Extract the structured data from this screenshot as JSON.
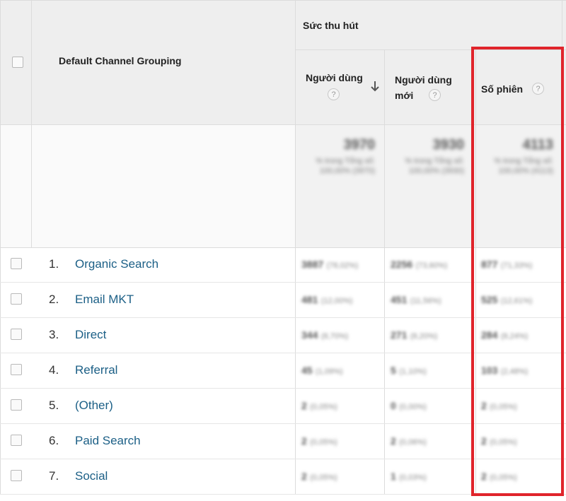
{
  "table": {
    "header_group": "Sức thu hút",
    "dimension_header": "Default Channel Grouping",
    "columns": [
      {
        "label": "Người dùng",
        "help": "?",
        "sorted_desc": true
      },
      {
        "label": "Người dùng mới",
        "help": "?"
      },
      {
        "label": "Số phiên",
        "help": "?"
      }
    ],
    "totals": [
      {
        "value": "3970",
        "sub": "% trong Tổng số: 100,00% (3970)"
      },
      {
        "value": "3930",
        "sub": "% trong Tổng số: 100,00% (3930)"
      },
      {
        "value": "4113",
        "sub": "% trong Tổng số: 100,00% (4113)"
      }
    ],
    "rows": [
      {
        "num": "1.",
        "channel": "Organic Search",
        "users": "3887",
        "users_pct": "(78,02%)",
        "new": "2256",
        "new_pct": "(73,60%)",
        "sessions": "877",
        "sessions_pct": "(71,33%)"
      },
      {
        "num": "2.",
        "channel": "Email MKT",
        "users": "481",
        "users_pct": "(12,00%)",
        "new": "451",
        "new_pct": "(11,56%)",
        "sessions": "525",
        "sessions_pct": "(12,61%)"
      },
      {
        "num": "3.",
        "channel": "Direct",
        "users": "344",
        "users_pct": "(8,70%)",
        "new": "271",
        "new_pct": "(8,20%)",
        "sessions": "284",
        "sessions_pct": "(8,24%)"
      },
      {
        "num": "4.",
        "channel": "Referral",
        "users": "45",
        "users_pct": "(1,09%)",
        "new": "5",
        "new_pct": "(1,10%)",
        "sessions": "103",
        "sessions_pct": "(2,48%)"
      },
      {
        "num": "5.",
        "channel": "(Other)",
        "users": "2",
        "users_pct": "(0,05%)",
        "new": "0",
        "new_pct": "(0,00%)",
        "sessions": "2",
        "sessions_pct": "(0,05%)"
      },
      {
        "num": "6.",
        "channel": "Paid Search",
        "users": "2",
        "users_pct": "(0,05%)",
        "new": "2",
        "new_pct": "(0,06%)",
        "sessions": "2",
        "sessions_pct": "(0,05%)"
      },
      {
        "num": "7.",
        "channel": "Social",
        "users": "2",
        "users_pct": "(0,05%)",
        "new": "1",
        "new_pct": "(0,03%)",
        "sessions": "2",
        "sessions_pct": "(0,05%)"
      }
    ]
  },
  "highlight": {
    "color": "#e0242b",
    "target_column": "Số phiên"
  }
}
